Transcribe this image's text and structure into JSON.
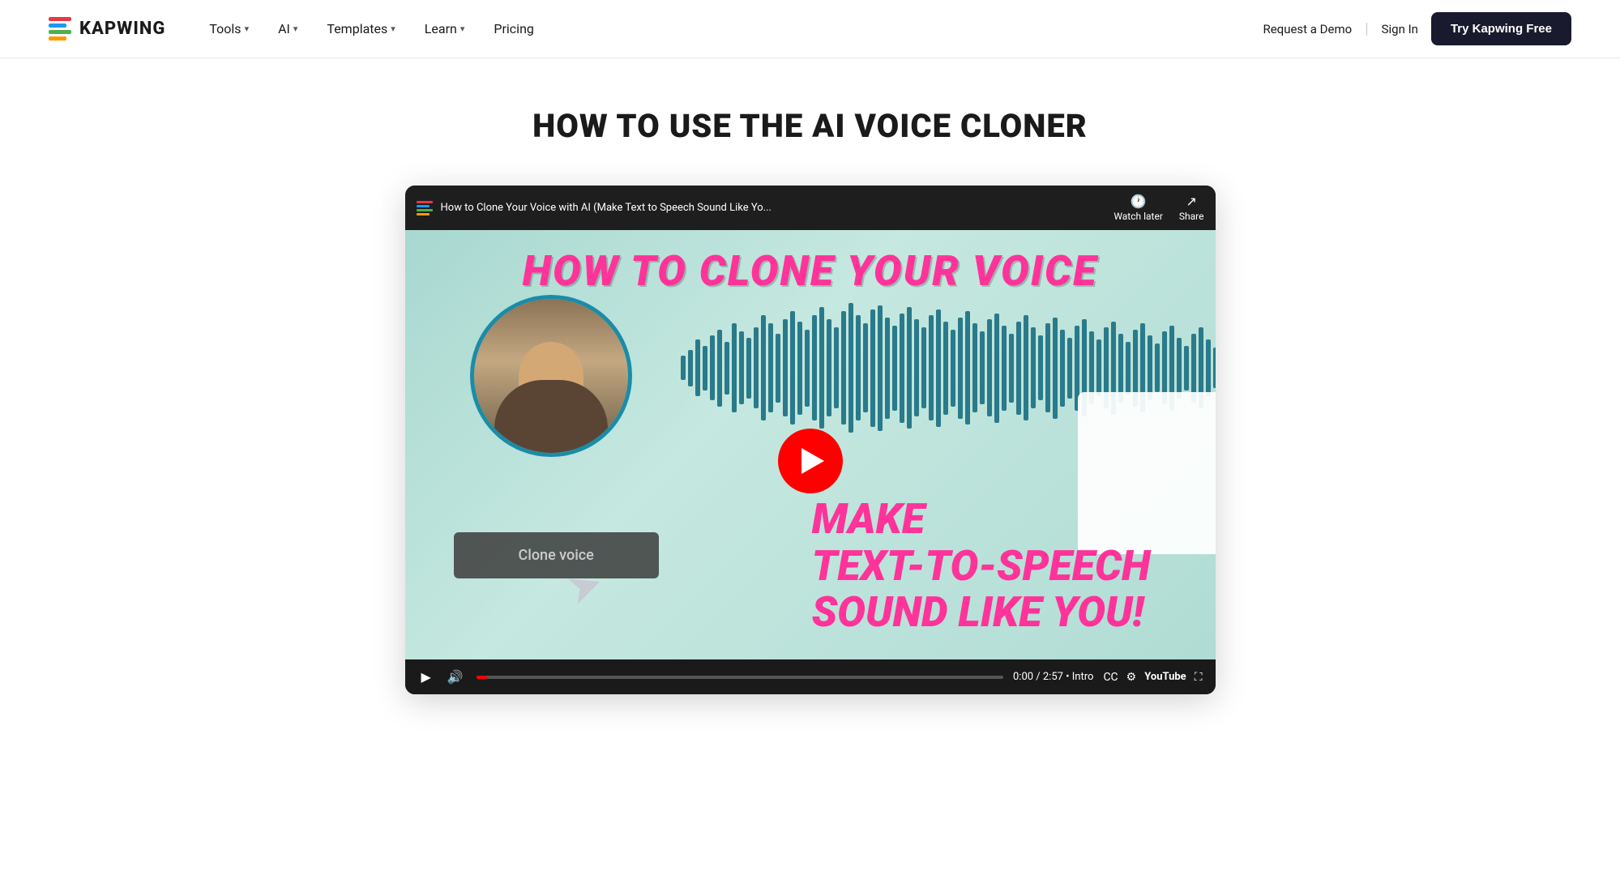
{
  "nav": {
    "logo_text": "KAPWING",
    "tools_label": "Tools",
    "ai_label": "AI",
    "templates_label": "Templates",
    "learn_label": "Learn",
    "pricing_label": "Pricing",
    "request_demo_label": "Request a Demo",
    "sign_in_label": "Sign In",
    "try_free_label": "Try Kapwing Free"
  },
  "main": {
    "page_title": "HOW TO USE THE AI VOICE CLONER",
    "video": {
      "youtube_title": "How to Clone Your Voice with AI (Make Text to Speech Sound Like Yo...",
      "watch_later_label": "Watch later",
      "share_label": "Share",
      "overlay_title": "HOW TO CLONE YOUR VOICE",
      "make_text_line1": "MAKE",
      "make_text_line2": "TEXT-TO-SPEECH",
      "make_text_line3": "SOUND LIKE YOU!",
      "clone_voice_label": "Clone voice",
      "time_display": "0:00 / 2:57 • Intro",
      "yt_wordmark": "YouTube"
    }
  },
  "colors": {
    "accent_pink": "#ff3399",
    "accent_teal": "#2a7a8a",
    "nav_dark": "#1a1a2e",
    "play_red": "#ff0000"
  }
}
